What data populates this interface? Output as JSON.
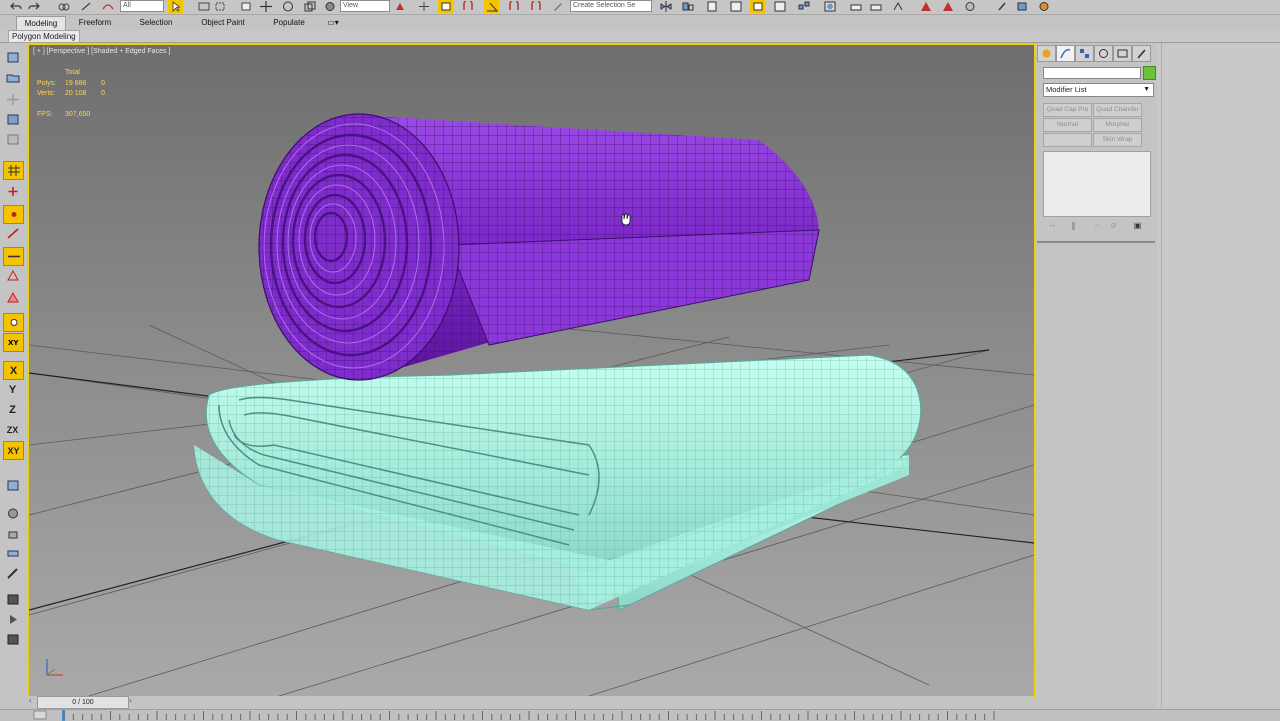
{
  "toolbar": {
    "selection_filter": "All",
    "reference_coord": "View",
    "named_selection_placeholder": "Create Selection Se"
  },
  "ribbon": {
    "tabs": [
      {
        "label": "Modeling",
        "active": true
      },
      {
        "label": "Freeform"
      },
      {
        "label": "Selection"
      },
      {
        "label": "Object Paint"
      },
      {
        "label": "Populate"
      }
    ],
    "panel_label": "Polygon Modeling"
  },
  "left_toolbar": {
    "constraints": [
      "X",
      "Y",
      "Z",
      "ZX",
      "XY"
    ]
  },
  "viewport": {
    "label": "[ + ] [Perspective ] [Shaded + Edged Faces ]",
    "stats": {
      "total_label": "Total",
      "polys_label": "Polys:",
      "polys_value": "19 686",
      "polys_sel": "0",
      "verts_label": "Verts:",
      "verts_value": "20 108",
      "verts_sel": "0",
      "fps_label": "FPS:",
      "fps_value": "307,650"
    },
    "objects": {
      "rolled_towel_color": "#7a26c8",
      "folded_towel_color": "#a6f0e0"
    },
    "highlight_color": "#f0d000"
  },
  "command_panel": {
    "modifier_list": "Modifier List",
    "modifier_buttons": [
      "Quad Cap Pro",
      "Quad Chamfer",
      "Normal",
      "Morpher",
      "",
      "Skin Wrap"
    ],
    "object_color": "#6cc23a"
  },
  "timeline": {
    "frame_readout": "0 / 100"
  },
  "track_bar": {
    "ticks": [
      "0",
      "5",
      "10",
      "15",
      "20",
      "25",
      "30",
      "35",
      "40",
      "45",
      "50",
      "55",
      "60",
      "65",
      "70",
      "75",
      "80",
      "85",
      "90",
      "95",
      "100"
    ]
  }
}
